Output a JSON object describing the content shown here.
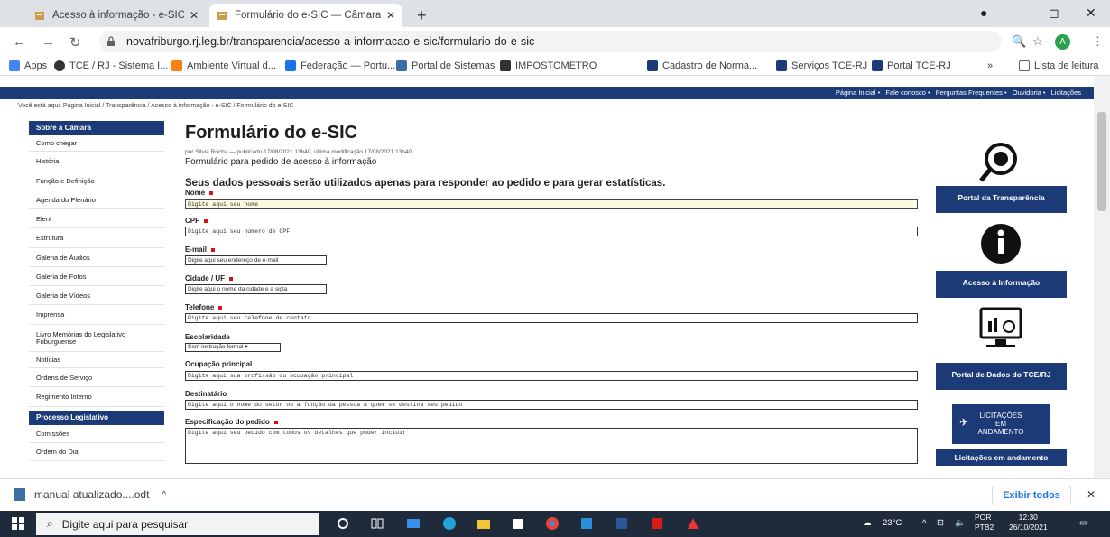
{
  "browser": {
    "tabs": [
      {
        "title": "Acesso à informação - e-SIC — C",
        "active": false
      },
      {
        "title": "Formulário do e-SIC — Câmara N",
        "active": true
      }
    ],
    "new_tab": "+",
    "url": "novafriburgo.rj.leg.br/transparencia/acesso-a-informacao-e-sic/formulario-do-e-sic",
    "avatar": "A",
    "bookmarks": [
      {
        "label": "Apps",
        "icon": "apps-grid-icon",
        "color": "#4285f4"
      },
      {
        "label": "TCE / RJ - Sistema I...",
        "icon": "globe-icon",
        "color": "#333333"
      },
      {
        "label": "Ambiente Virtual d...",
        "icon": "moodle-icon",
        "color": "#f98012"
      },
      {
        "label": "Federação — Portu...",
        "icon": "federation-icon",
        "color": "#1a73e8"
      },
      {
        "label": "Portal de Sistemas",
        "icon": "portal-icon",
        "color": "#3a6ea5"
      },
      {
        "label": "IMPOSTOMETRO",
        "icon": "impostometro-icon",
        "color": "#333333"
      },
      {
        "label": "Cadastro de Norma...",
        "icon": "tce-icon",
        "color": "#1c3a78"
      },
      {
        "label": "Serviços TCE-RJ",
        "icon": "tce-icon",
        "color": "#1c3a78"
      },
      {
        "label": "Portal TCE-RJ",
        "icon": "tce-icon",
        "color": "#1c3a78"
      }
    ],
    "bookmarks_more": "»",
    "reading_list": "Lista de leitura"
  },
  "page": {
    "topnav": [
      "Página Inicial",
      "Fale conosco",
      "Perguntas Frequentes",
      "Ouvidoria",
      "Licitações"
    ],
    "breadcrumb": "Você está aqui: Página Inicial / Transparência / Acesso à informação - e-SIC / Formulário do e-SIC",
    "sidebar": {
      "section1": "Sobre a Câmara",
      "items1": [
        "Como chegar",
        "História",
        "Função e Definição",
        "Agenda do Plenário",
        "Elenf",
        "Estrutura",
        "Galeria de Áudios",
        "Galeria de Fotos",
        "Galeria de Vídeos",
        "Imprensa",
        "Livro Memórias do Legislativo Friburguense",
        "Notícias",
        "Ordens de Serviço",
        "Regimento Interno"
      ],
      "section2": "Processo Legislativo",
      "items2": [
        "Comissões",
        "Ordem do Dia"
      ]
    },
    "title": "Formulário do e-SIC",
    "byline": "por Silvia Rocha — publicado 17/08/2021 13h40, última modificação 17/08/2021 13h40",
    "description": "Formulário para pedido de acesso à informação",
    "notice": "Seus dados pessoais serão utilizados apenas para responder ao pedido e para gerar estatísticas.",
    "fields": {
      "nome": {
        "label": "Nome",
        "placeholder": "Digite aqui seu nome"
      },
      "cpf": {
        "label": "CPF",
        "placeholder": "Digite aqui seu número de CPF"
      },
      "email": {
        "label": "E-mail",
        "placeholder": "Digite aqui seu endereço de e-mail"
      },
      "cidade": {
        "label": "Cidade / UF",
        "placeholder": "Digite aqui o nome da cidade e a sigla"
      },
      "telefone": {
        "label": "Telefone",
        "placeholder": "Digite aqui seu telefone de contato"
      },
      "escolaridade": {
        "label": "Escolaridade",
        "value": "Sem instrução formal"
      },
      "ocupacao": {
        "label": "Ocupação principal",
        "placeholder": "Digite aqui sua profissão ou ocupação principal"
      },
      "destinatario": {
        "label": "Destinatário",
        "placeholder": "Digite aqui o nome do setor ou a função da pessoa a quem se destina seu pedido"
      },
      "pedido": {
        "label": "Especificação do pedido",
        "placeholder": "Digite aqui seu pedido com todos os detalhes que puder incluir"
      }
    },
    "right_banners": [
      {
        "title": "Portal da Transparência",
        "icon": "magnifier-icon"
      },
      {
        "title": "Acesso à Informação",
        "icon": "info-icon"
      },
      {
        "title": "Portal de Dados do TCE/RJ",
        "icon": "monitor-chart-icon"
      },
      {
        "title": "Licitações em andamento",
        "icon": "licitacoes-icon",
        "badge": [
          "LICITAÇÕES",
          "EM",
          "ANDAMENTO"
        ]
      }
    ]
  },
  "downloads": {
    "file": "manual atualizado....odt",
    "show_all": "Exibir todos"
  },
  "taskbar": {
    "search_placeholder": "Digite aqui para pesquisar",
    "temperature": "23°C",
    "lang1": "POR",
    "lang2": "PTB2",
    "time": "12:30",
    "date": "26/10/2021"
  }
}
